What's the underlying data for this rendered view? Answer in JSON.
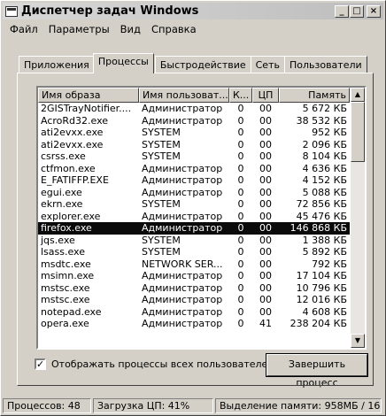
{
  "window": {
    "title": "Диспетчер задач Windows",
    "minimize": "_",
    "maximize": "□",
    "close": "×"
  },
  "menu": [
    "Файл",
    "Параметры",
    "Вид",
    "Справка"
  ],
  "tabs": [
    "Приложения",
    "Процессы",
    "Быстродействие",
    "Сеть",
    "Пользователи"
  ],
  "active_tab": "Процессы",
  "table": {
    "columns": [
      "Имя образа",
      "Имя пользоват...",
      "К...",
      "ЦП",
      "Память"
    ],
    "rows": [
      [
        "2GISTrayNotifier....",
        "Администратор",
        "0",
        "00",
        "5 672 КБ"
      ],
      [
        "AcroRd32.exe",
        "Администратор",
        "0",
        "00",
        "38 532 КБ"
      ],
      [
        "ati2evxx.exe",
        "SYSTEM",
        "0",
        "00",
        "952 КБ"
      ],
      [
        "ati2evxx.exe",
        "SYSTEM",
        "0",
        "00",
        "2 096 КБ"
      ],
      [
        "csrss.exe",
        "SYSTEM",
        "0",
        "00",
        "8 104 КБ"
      ],
      [
        "ctfmon.exe",
        "Администратор",
        "0",
        "00",
        "4 636 КБ"
      ],
      [
        "E_FATIFFP.EXE",
        "Администратор",
        "0",
        "00",
        "4 152 КБ"
      ],
      [
        "egui.exe",
        "Администратор",
        "0",
        "00",
        "5 088 КБ"
      ],
      [
        "ekrn.exe",
        "SYSTEM",
        "0",
        "00",
        "72 856 КБ"
      ],
      [
        "explorer.exe",
        "Администратор",
        "0",
        "00",
        "45 476 КБ"
      ],
      [
        "firefox.exe",
        "Администратор",
        "0",
        "00",
        "146 868 КБ"
      ],
      [
        "jqs.exe",
        "SYSTEM",
        "0",
        "00",
        "1 388 КБ"
      ],
      [
        "lsass.exe",
        "SYSTEM",
        "0",
        "00",
        "5 892 КБ"
      ],
      [
        "msdtc.exe",
        "NETWORK SER...",
        "0",
        "00",
        "792 КБ"
      ],
      [
        "msimn.exe",
        "Администратор",
        "0",
        "00",
        "17 104 КБ"
      ],
      [
        "mstsc.exe",
        "Администратор",
        "0",
        "00",
        "10 796 КБ"
      ],
      [
        "mstsc.exe",
        "Администратор",
        "0",
        "00",
        "12 016 КБ"
      ],
      [
        "notepad.exe",
        "Администратор",
        "0",
        "00",
        "4 608 КБ"
      ],
      [
        "opera.exe",
        "Администратор",
        "0",
        "41",
        "238 204 КБ"
      ]
    ],
    "selected_row": 10
  },
  "show_all_label": "Отображать процессы всех пользователей",
  "show_all_checked": "✓",
  "end_process_label": "Завершить процесс",
  "status": {
    "processes": "Процессов: 48",
    "cpu": "Загрузка ЦП: 41%",
    "memory": "Выделение памяти: 958МБ / 16"
  },
  "colors": {
    "face": "#d4d0c8",
    "selection": "#0a0a0a"
  }
}
